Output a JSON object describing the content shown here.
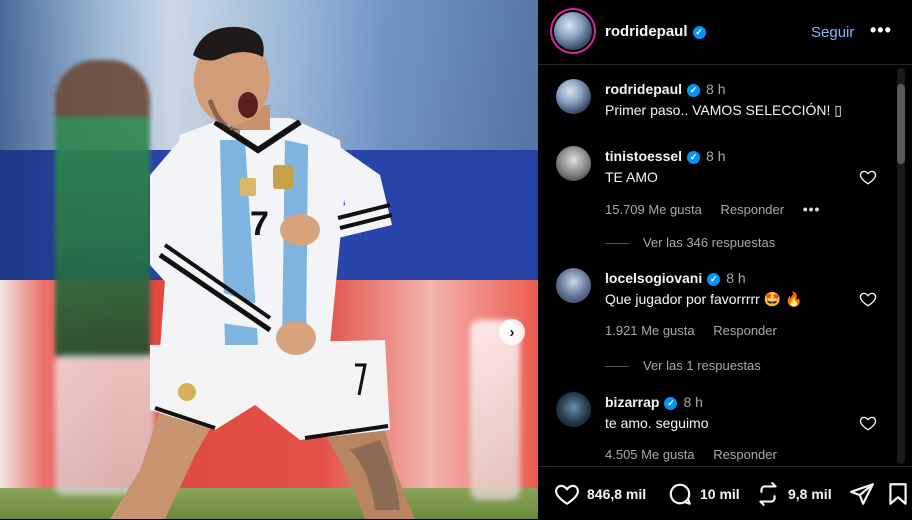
{
  "post": {
    "image_alt": "photo",
    "next_glyph": "›"
  },
  "header": {
    "username": "rodridepaul",
    "follow_label": "Seguir",
    "more_glyph": "•••"
  },
  "comments": [
    {
      "username": "rodridepaul",
      "verified": true,
      "time": "8 h",
      "text": "Primer paso.. VAMOS SELECCIÓN! ▯",
      "caption": true
    },
    {
      "username": "tinistoessel",
      "verified": true,
      "time": "8 h",
      "text": "TE AMO",
      "likes": "15.709 Me gusta",
      "reply_label": "Responder",
      "replies": "Ver las 346 respuestas"
    },
    {
      "username": "locelsogiovani",
      "verified": true,
      "time": "8 h",
      "text": "Que jugador por favorrrrr 🤩 🔥",
      "likes": "1.921 Me gusta",
      "reply_label": "Responder",
      "replies": "Ver las 1 respuestas"
    },
    {
      "username": "bizarrap",
      "verified": true,
      "time": "8 h",
      "text": "te amo. seguimo",
      "likes": "4.505 Me gusta",
      "reply_label": "Responder"
    }
  ],
  "actions": {
    "likes": "846,8 mil",
    "comments": "10 mil",
    "reposts": "9,8 mil"
  },
  "colors": {
    "accent": "#0095f6",
    "follow": "#83b6f9",
    "muted": "#a8a8a8"
  },
  "icons": [
    "chevron-right-icon",
    "verified-icon",
    "more-icon",
    "heart-icon",
    "comment-icon",
    "repost-icon",
    "share-icon",
    "bookmark-icon"
  ]
}
